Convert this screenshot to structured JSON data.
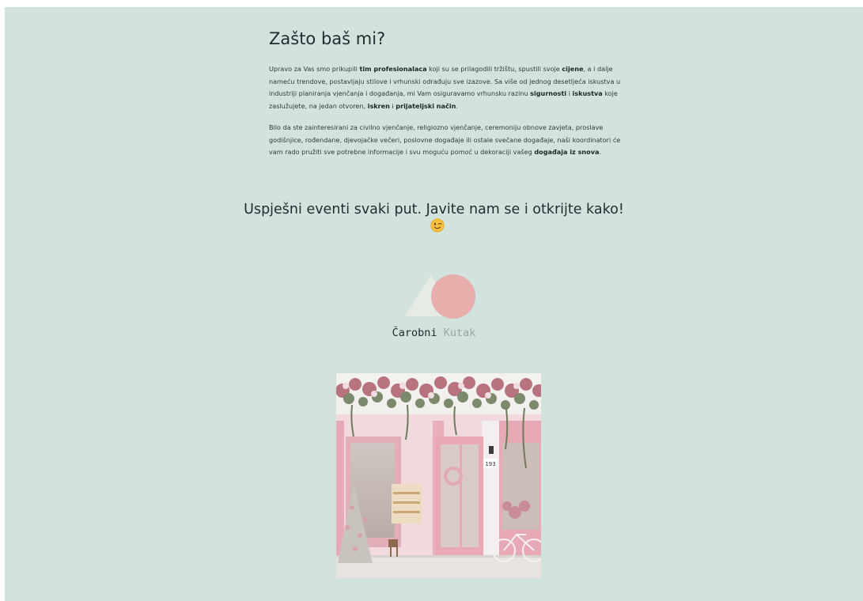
{
  "section": {
    "heading": "Zašto baš mi?",
    "paragraph1": [
      {
        "t": "Upravo za Vas smo prikupili ",
        "b": false
      },
      {
        "t": "tim profesionalaca",
        "b": true
      },
      {
        "t": " koji su se prilagodili tržištu, spustili svoje ",
        "b": false
      },
      {
        "t": "cijene",
        "b": true
      },
      {
        "t": ", a i dalje nameću trendove, postavljaju stilove i vrhunski odrađuju sve izazove. Sa više od jednog desetljeća iskustva u industriji planiranja vjenčanja i događanja, mi Vam osiguravamo vrhunsku razinu ",
        "b": false
      },
      {
        "t": "sigurnosti",
        "b": true
      },
      {
        "t": " i ",
        "b": false
      },
      {
        "t": "iskustva",
        "b": true
      },
      {
        "t": " koje zaslužujete, na jedan otvoren, ",
        "b": false
      },
      {
        "t": "iskren",
        "b": true
      },
      {
        "t": " i ",
        "b": false
      },
      {
        "t": "prijateljski način",
        "b": true
      },
      {
        "t": ".",
        "b": false
      }
    ],
    "paragraph2": [
      {
        "t": "Bilo da ste zainteresirani za civilno vjenčanje, religiozno vjenčanje, ceremoniju obnove zavjeta, proslave godišnjice, rođendane, djevojačke večeri, poslovne događaje ili ostale svečane događaje, naši koordinatori će vam rado pružiti sve potrebne informacije i svu moguću pomoć u dekoraciji vašeg ",
        "b": false
      },
      {
        "t": "događaja iz snova",
        "b": true
      },
      {
        "t": ".",
        "b": false
      }
    ]
  },
  "cta": {
    "text": "Uspješni eventi svaki put. Javite nam se i otkrijte kako!",
    "emoji_icon": "winking-face-icon"
  },
  "logo": {
    "word1": "Čarobni",
    "word2": "Kutak",
    "triangle_color": "#e6ebe3",
    "circle_color": "#e7aeac"
  },
  "photo": {
    "icon": "flower-shop-storefront-image",
    "house_number": "193"
  },
  "colors": {
    "page_background": "#d2e3dd",
    "text": "#1f2d33"
  }
}
